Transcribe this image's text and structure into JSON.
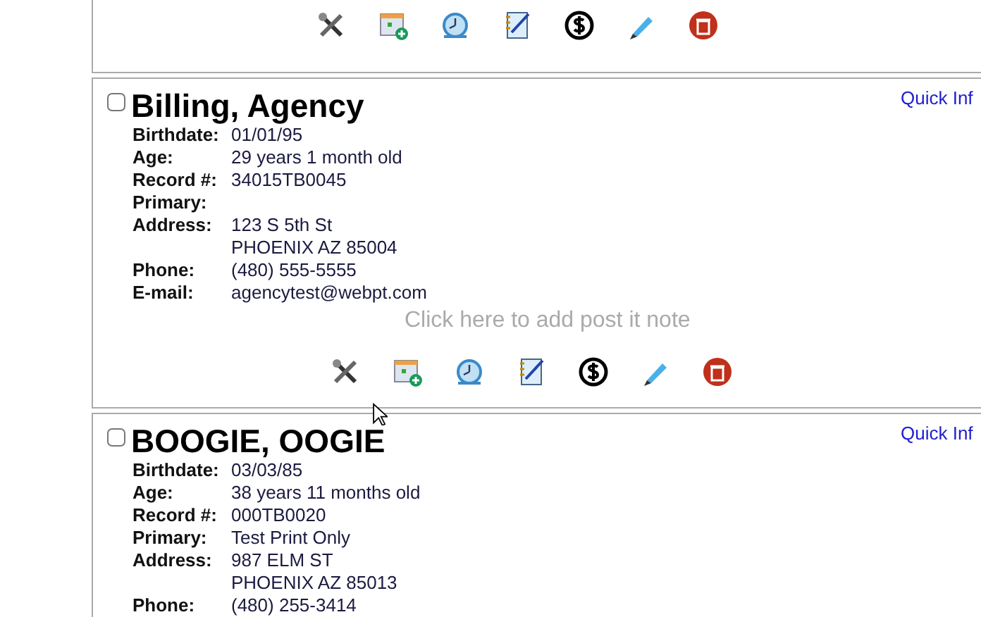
{
  "patients": [
    {
      "kind": "cut_off"
    },
    {
      "kind": "full",
      "name": "Billing, Agency",
      "checked": false,
      "quick_info": "Quick Inf",
      "post_it": "Click here to add post it note",
      "fields": [
        {
          "label": "Birthdate:",
          "value": [
            "01/01/95"
          ]
        },
        {
          "label": "Age:",
          "value": [
            "29 years 1 month old"
          ]
        },
        {
          "label": "Record #:",
          "value": [
            "34015TB0045"
          ]
        },
        {
          "label": "Primary:"
        },
        {
          "label": "Address:",
          "value": [
            "123 S 5th St",
            "PHOENIX AZ 85004"
          ]
        },
        {
          "label": "Phone:",
          "value": [
            "(480) 555-5555"
          ]
        },
        {
          "label": "E-mail:",
          "value": [
            "agencytest@webpt.com"
          ]
        }
      ]
    },
    {
      "kind": "cut_bottom",
      "name": "BOOGIE, OOGIE",
      "checked": false,
      "quick_info": "Quick Inf",
      "fields": [
        {
          "label": "Birthdate:",
          "value": [
            "03/03/85"
          ]
        },
        {
          "label": "Age:",
          "value": [
            "38 years 11 months old"
          ]
        },
        {
          "label": "Record #:",
          "value": [
            "000TB0020"
          ]
        },
        {
          "label": "Primary:",
          "value": [
            "Test Print Only"
          ]
        },
        {
          "label": "Address:",
          "value": [
            "987 ELM ST",
            "PHOENIX AZ 85013"
          ]
        },
        {
          "label": "Phone:",
          "value": [
            "(480) 255-3414"
          ]
        }
      ]
    }
  ]
}
